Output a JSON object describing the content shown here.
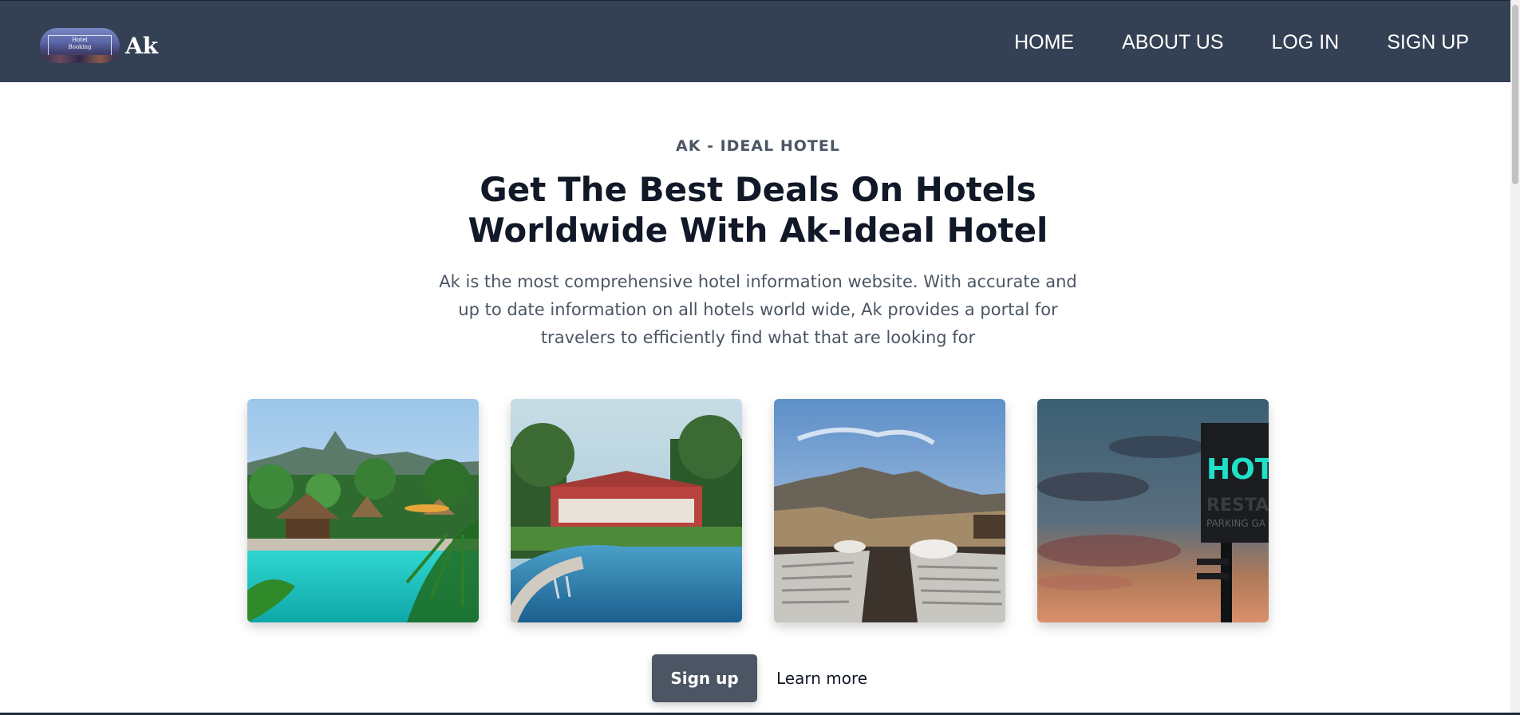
{
  "nav": {
    "brand": "Ak",
    "logo_text_top": "Hotel",
    "logo_text_bottom": "Booking",
    "links": [
      "HOME",
      "ABOUT US",
      "LOG IN",
      "SIGN UP"
    ]
  },
  "hero": {
    "eyebrow": "AK - IDEAL HOTEL",
    "title_line1": "Get The Best Deals On Hotels",
    "title_line2": "Worldwide With Ak-Ideal Hotel",
    "description": "Ak is the most comprehensive hotel information website. With accurate and up to date information on all hotels world wide, Ak provides a portal for travelers to efficiently find what that are looking for"
  },
  "gallery": [
    {
      "name": "tropical-pool-image"
    },
    {
      "name": "resort-pool-image"
    },
    {
      "name": "mountain-terrace-image"
    },
    {
      "name": "hotel-neon-sign-image",
      "sign_text": "HOTEL",
      "sub_text": "RESTAURA",
      "sub_text2": "PARKING GA"
    }
  ],
  "actions": {
    "signup_label": "Sign up",
    "learn_more_label": "Learn more"
  },
  "colors": {
    "navbar": "#344154",
    "primary_button": "#4b5563",
    "heading": "#111827",
    "body_text": "#4b5563"
  }
}
